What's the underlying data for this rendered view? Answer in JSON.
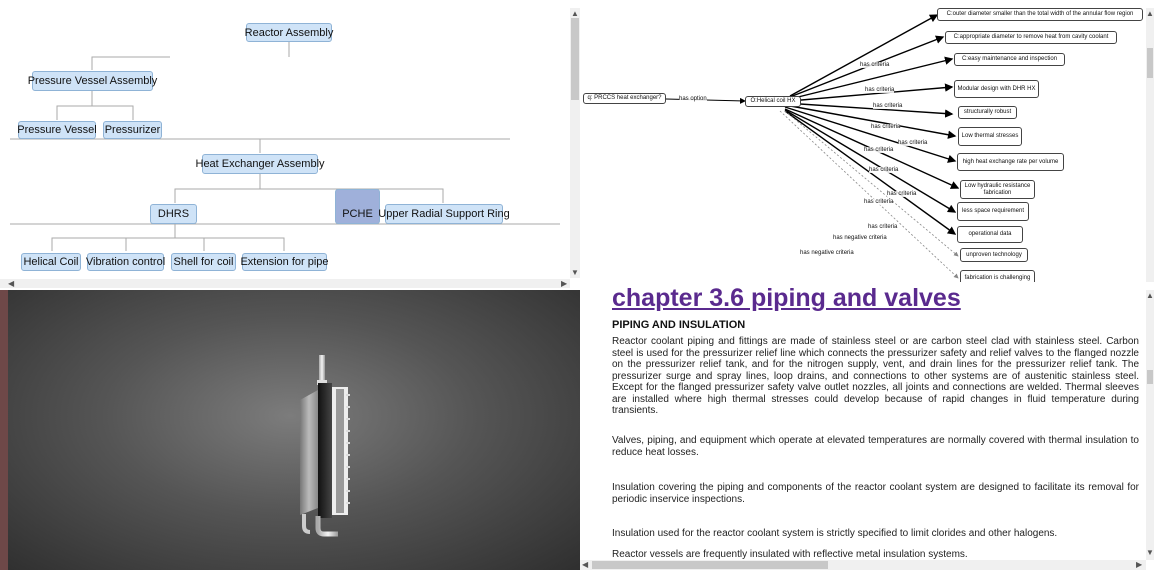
{
  "tree": {
    "nodes": {
      "reactor_assembly": "Reactor Assembly",
      "pressure_vessel_assembly": "Pressure Vessel Assembly",
      "pressure_vessel": "Pressure Vessel",
      "pressurizer": "Pressurizer",
      "heat_exchanger_assembly": "Heat Exchanger Assembly",
      "dhrs": "DHRS",
      "pche": "PCHE",
      "upper_radial_support_ring": "Upper Radial Support Ring",
      "helical_coil": "Helical Coil",
      "vibration_control": "Vibration control",
      "shell_for_coil": "Shell for coil",
      "extension_for_pipe": "Extension for pipe"
    },
    "selected": "pche"
  },
  "graph": {
    "question": "q: PRCCS heat exchanger?",
    "option": "O:Helical coil HX",
    "option_edge": "has option",
    "criteria_edge": "has criteria",
    "negative_edge": "has negative criteria",
    "criteria": [
      "C:outer diameter smaller than the total width of the annular flow region",
      "C:appropriate diameter to remove heat from cavity coolant",
      "C:easy maintenance and inspection",
      "Modular design with DHR HX",
      "structurally robust",
      "Low thermal stresses",
      "high heat exchange rate per volume",
      "Low hydraulic resistance fabrication",
      "less space requirement",
      "operational data"
    ],
    "negatives": [
      "unproven technology",
      "fabrication is challenging"
    ]
  },
  "document": {
    "title": "chapter 3.6 piping and valves",
    "subtitle": "PIPING AND INSULATION",
    "paragraphs": [
      "Reactor coolant piping and fittings are made of stainless steel or are carbon steel clad with stainless steel. Carbon steel is used for the pressurizer relief line which connects the pressurizer safety and relief valves to the flanged nozzle on the pressurizer relief tank, and for the nitrogen supply, vent, and drain lines for the pressurizer relief tank. The pressurizer surge and spray lines, loop drains, and connections to other systems are of austenitic stainless steel. Except for the flanged pressurizer safety valve outlet nozzles, all joints and connections are welded. Thermal sleeves are installed where high thermal stresses could develop because of rapid changes in fluid temperature during transients.",
      "Valves, piping, and equipment which operate at elevated temperatures are normally covered with thermal insulation to reduce heat losses.",
      "Insulation covering the piping and components of the reactor coolant system are designed to facilitate its removal for periodic inservice inspections.",
      "Insulation used for the reactor coolant system is strictly specified to limit clorides and other halogens.",
      "Reactor vessels are frequently insulated with reflective metal insulation systems."
    ]
  },
  "colors": {
    "node_fill": "#cfe3f7",
    "node_selected": "#9fb0da",
    "doc_title": "#5a2a8e"
  }
}
